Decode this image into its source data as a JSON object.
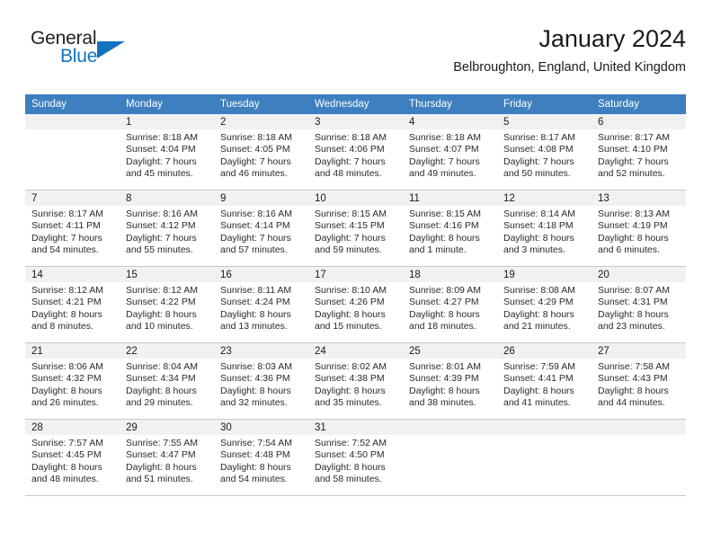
{
  "brand": {
    "name_part1": "General",
    "name_part2": "Blue",
    "triangle_color": "#1173c0"
  },
  "header": {
    "title": "January 2024",
    "subtitle": "Belbroughton, England, United Kingdom"
  },
  "theme": {
    "header_row_bg": "#3d7fbf",
    "daynum_bg": "#f1f1f1",
    "grid_line": "#c8c8c8",
    "text": "#1a1a1a"
  },
  "calendar": {
    "weekday_headers": [
      "Sunday",
      "Monday",
      "Tuesday",
      "Wednesday",
      "Thursday",
      "Friday",
      "Saturday"
    ],
    "weeks": [
      [
        {
          "day": "",
          "empty": true,
          "sunrise": "",
          "sunset": "",
          "daylight_line1": "",
          "daylight_line2": ""
        },
        {
          "day": "1",
          "sunrise": "Sunrise: 8:18 AM",
          "sunset": "Sunset: 4:04 PM",
          "daylight_line1": "Daylight: 7 hours",
          "daylight_line2": "and 45 minutes."
        },
        {
          "day": "2",
          "sunrise": "Sunrise: 8:18 AM",
          "sunset": "Sunset: 4:05 PM",
          "daylight_line1": "Daylight: 7 hours",
          "daylight_line2": "and 46 minutes."
        },
        {
          "day": "3",
          "sunrise": "Sunrise: 8:18 AM",
          "sunset": "Sunset: 4:06 PM",
          "daylight_line1": "Daylight: 7 hours",
          "daylight_line2": "and 48 minutes."
        },
        {
          "day": "4",
          "sunrise": "Sunrise: 8:18 AM",
          "sunset": "Sunset: 4:07 PM",
          "daylight_line1": "Daylight: 7 hours",
          "daylight_line2": "and 49 minutes."
        },
        {
          "day": "5",
          "sunrise": "Sunrise: 8:17 AM",
          "sunset": "Sunset: 4:08 PM",
          "daylight_line1": "Daylight: 7 hours",
          "daylight_line2": "and 50 minutes."
        },
        {
          "day": "6",
          "sunrise": "Sunrise: 8:17 AM",
          "sunset": "Sunset: 4:10 PM",
          "daylight_line1": "Daylight: 7 hours",
          "daylight_line2": "and 52 minutes."
        }
      ],
      [
        {
          "day": "7",
          "sunrise": "Sunrise: 8:17 AM",
          "sunset": "Sunset: 4:11 PM",
          "daylight_line1": "Daylight: 7 hours",
          "daylight_line2": "and 54 minutes."
        },
        {
          "day": "8",
          "sunrise": "Sunrise: 8:16 AM",
          "sunset": "Sunset: 4:12 PM",
          "daylight_line1": "Daylight: 7 hours",
          "daylight_line2": "and 55 minutes."
        },
        {
          "day": "9",
          "sunrise": "Sunrise: 8:16 AM",
          "sunset": "Sunset: 4:14 PM",
          "daylight_line1": "Daylight: 7 hours",
          "daylight_line2": "and 57 minutes."
        },
        {
          "day": "10",
          "sunrise": "Sunrise: 8:15 AM",
          "sunset": "Sunset: 4:15 PM",
          "daylight_line1": "Daylight: 7 hours",
          "daylight_line2": "and 59 minutes."
        },
        {
          "day": "11",
          "sunrise": "Sunrise: 8:15 AM",
          "sunset": "Sunset: 4:16 PM",
          "daylight_line1": "Daylight: 8 hours",
          "daylight_line2": "and 1 minute."
        },
        {
          "day": "12",
          "sunrise": "Sunrise: 8:14 AM",
          "sunset": "Sunset: 4:18 PM",
          "daylight_line1": "Daylight: 8 hours",
          "daylight_line2": "and 3 minutes."
        },
        {
          "day": "13",
          "sunrise": "Sunrise: 8:13 AM",
          "sunset": "Sunset: 4:19 PM",
          "daylight_line1": "Daylight: 8 hours",
          "daylight_line2": "and 6 minutes."
        }
      ],
      [
        {
          "day": "14",
          "sunrise": "Sunrise: 8:12 AM",
          "sunset": "Sunset: 4:21 PM",
          "daylight_line1": "Daylight: 8 hours",
          "daylight_line2": "and 8 minutes."
        },
        {
          "day": "15",
          "sunrise": "Sunrise: 8:12 AM",
          "sunset": "Sunset: 4:22 PM",
          "daylight_line1": "Daylight: 8 hours",
          "daylight_line2": "and 10 minutes."
        },
        {
          "day": "16",
          "sunrise": "Sunrise: 8:11 AM",
          "sunset": "Sunset: 4:24 PM",
          "daylight_line1": "Daylight: 8 hours",
          "daylight_line2": "and 13 minutes."
        },
        {
          "day": "17",
          "sunrise": "Sunrise: 8:10 AM",
          "sunset": "Sunset: 4:26 PM",
          "daylight_line1": "Daylight: 8 hours",
          "daylight_line2": "and 15 minutes."
        },
        {
          "day": "18",
          "sunrise": "Sunrise: 8:09 AM",
          "sunset": "Sunset: 4:27 PM",
          "daylight_line1": "Daylight: 8 hours",
          "daylight_line2": "and 18 minutes."
        },
        {
          "day": "19",
          "sunrise": "Sunrise: 8:08 AM",
          "sunset": "Sunset: 4:29 PM",
          "daylight_line1": "Daylight: 8 hours",
          "daylight_line2": "and 21 minutes."
        },
        {
          "day": "20",
          "sunrise": "Sunrise: 8:07 AM",
          "sunset": "Sunset: 4:31 PM",
          "daylight_line1": "Daylight: 8 hours",
          "daylight_line2": "and 23 minutes."
        }
      ],
      [
        {
          "day": "21",
          "sunrise": "Sunrise: 8:06 AM",
          "sunset": "Sunset: 4:32 PM",
          "daylight_line1": "Daylight: 8 hours",
          "daylight_line2": "and 26 minutes."
        },
        {
          "day": "22",
          "sunrise": "Sunrise: 8:04 AM",
          "sunset": "Sunset: 4:34 PM",
          "daylight_line1": "Daylight: 8 hours",
          "daylight_line2": "and 29 minutes."
        },
        {
          "day": "23",
          "sunrise": "Sunrise: 8:03 AM",
          "sunset": "Sunset: 4:36 PM",
          "daylight_line1": "Daylight: 8 hours",
          "daylight_line2": "and 32 minutes."
        },
        {
          "day": "24",
          "sunrise": "Sunrise: 8:02 AM",
          "sunset": "Sunset: 4:38 PM",
          "daylight_line1": "Daylight: 8 hours",
          "daylight_line2": "and 35 minutes."
        },
        {
          "day": "25",
          "sunrise": "Sunrise: 8:01 AM",
          "sunset": "Sunset: 4:39 PM",
          "daylight_line1": "Daylight: 8 hours",
          "daylight_line2": "and 38 minutes."
        },
        {
          "day": "26",
          "sunrise": "Sunrise: 7:59 AM",
          "sunset": "Sunset: 4:41 PM",
          "daylight_line1": "Daylight: 8 hours",
          "daylight_line2": "and 41 minutes."
        },
        {
          "day": "27",
          "sunrise": "Sunrise: 7:58 AM",
          "sunset": "Sunset: 4:43 PM",
          "daylight_line1": "Daylight: 8 hours",
          "daylight_line2": "and 44 minutes."
        }
      ],
      [
        {
          "day": "28",
          "sunrise": "Sunrise: 7:57 AM",
          "sunset": "Sunset: 4:45 PM",
          "daylight_line1": "Daylight: 8 hours",
          "daylight_line2": "and 48 minutes."
        },
        {
          "day": "29",
          "sunrise": "Sunrise: 7:55 AM",
          "sunset": "Sunset: 4:47 PM",
          "daylight_line1": "Daylight: 8 hours",
          "daylight_line2": "and 51 minutes."
        },
        {
          "day": "30",
          "sunrise": "Sunrise: 7:54 AM",
          "sunset": "Sunset: 4:48 PM",
          "daylight_line1": "Daylight: 8 hours",
          "daylight_line2": "and 54 minutes."
        },
        {
          "day": "31",
          "sunrise": "Sunrise: 7:52 AM",
          "sunset": "Sunset: 4:50 PM",
          "daylight_line1": "Daylight: 8 hours",
          "daylight_line2": "and 58 minutes."
        },
        {
          "day": "",
          "empty": true,
          "sunrise": "",
          "sunset": "",
          "daylight_line1": "",
          "daylight_line2": ""
        },
        {
          "day": "",
          "empty": true,
          "sunrise": "",
          "sunset": "",
          "daylight_line1": "",
          "daylight_line2": ""
        },
        {
          "day": "",
          "empty": true,
          "sunrise": "",
          "sunset": "",
          "daylight_line1": "",
          "daylight_line2": ""
        }
      ]
    ]
  }
}
